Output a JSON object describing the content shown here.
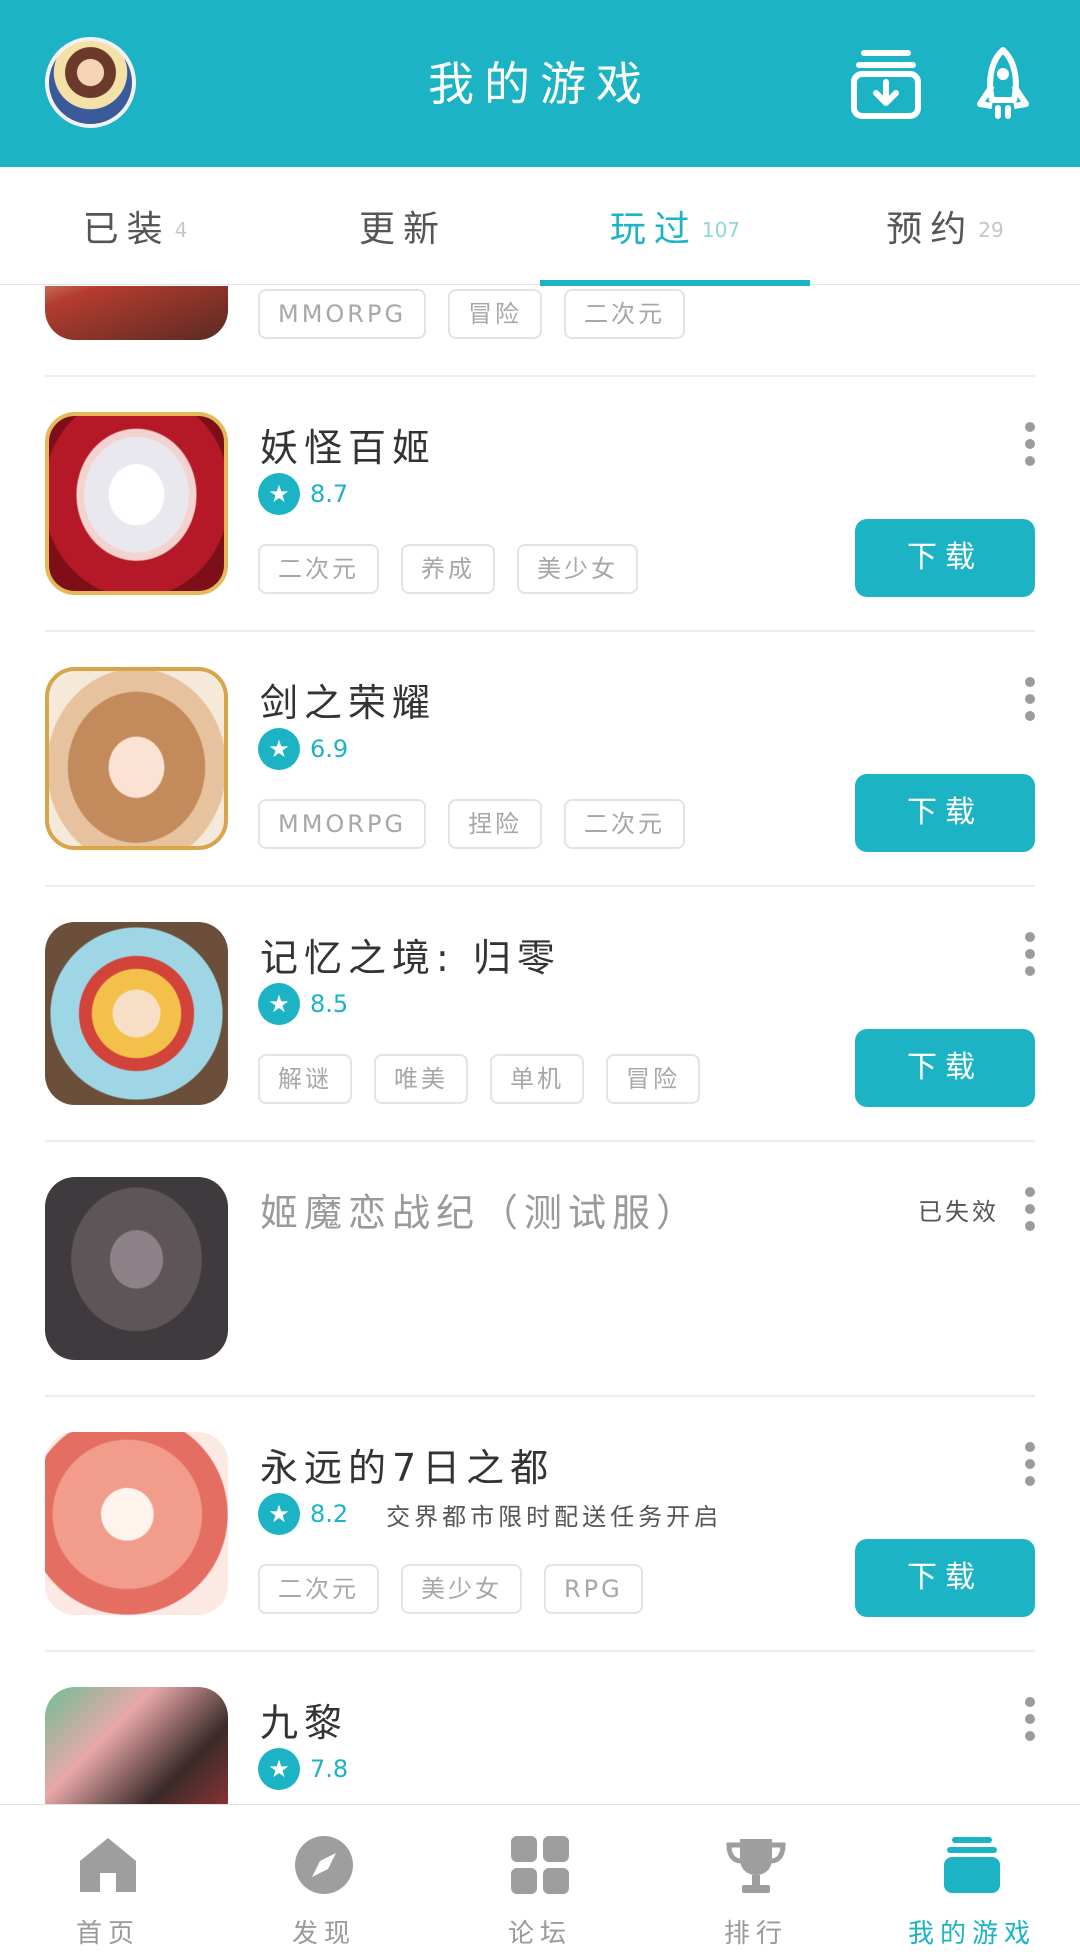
{
  "header": {
    "title": "我的游戏",
    "avatar_icon": "user-avatar",
    "download_icon": "download-manager-icon",
    "rocket_icon": "rocket-icon"
  },
  "tabs": [
    {
      "label": "已装",
      "count": "4"
    },
    {
      "label": "更新",
      "count": ""
    },
    {
      "label": "玩过",
      "count": "107"
    },
    {
      "label": "预约",
      "count": "29"
    }
  ],
  "active_tab": "玩过",
  "games": [
    {
      "name": "",
      "score": "",
      "tags": [
        "MMORPG",
        "冒险",
        "二次元"
      ]
    },
    {
      "name": "妖怪百姬",
      "score": "8.7",
      "tags": [
        "二次元",
        "养成",
        "美少女"
      ],
      "button": "下载"
    },
    {
      "name": "剑之荣耀",
      "score": "6.9",
      "tags": [
        "MMORPG",
        "捏险",
        "二次元"
      ],
      "button": "下载"
    },
    {
      "name": "记忆之境: 归零",
      "score": "8.5",
      "tags": [
        "解谜",
        "唯美",
        "单机",
        "冒险"
      ],
      "button": "下载"
    },
    {
      "name": "姬魔恋战纪（测试服）",
      "status": "已失效"
    },
    {
      "name": "永远的7日之都",
      "score": "8.2",
      "promo": "交界都市限时配送任务开启",
      "tags": [
        "二次元",
        "美少女",
        "RPG"
      ],
      "button": "下载"
    },
    {
      "name": "九黎",
      "score": "7.8"
    }
  ],
  "bottom_nav": [
    {
      "label": "首页",
      "icon": "home-icon"
    },
    {
      "label": "发现",
      "icon": "compass-icon"
    },
    {
      "label": "论坛",
      "icon": "grid-icon"
    },
    {
      "label": "排行",
      "icon": "trophy-icon"
    },
    {
      "label": "我的游戏",
      "icon": "my-games-icon"
    }
  ],
  "colors": {
    "accent": "#1cb3c4",
    "tag_border": "#e3e3e3",
    "tag_text": "#a7a7a7"
  }
}
